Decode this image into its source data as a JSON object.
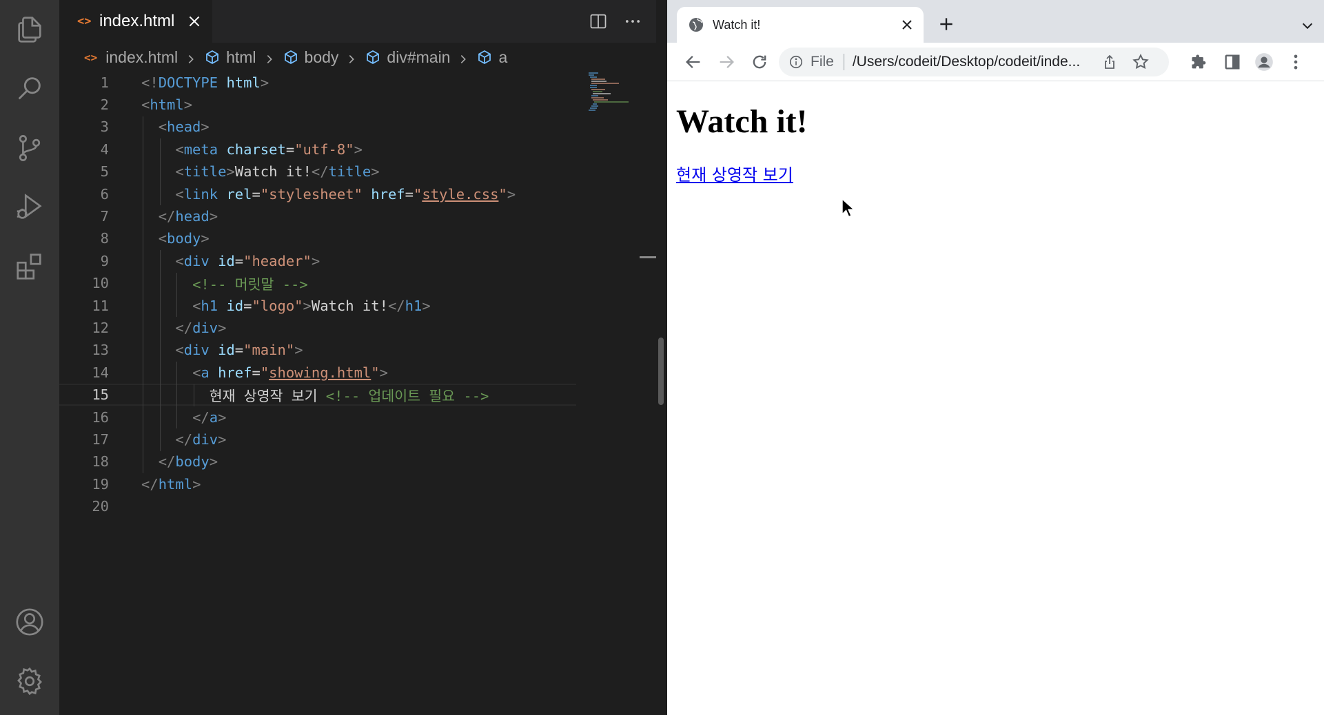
{
  "editor": {
    "tab": {
      "icon": "<>",
      "label": "index.html"
    },
    "breadcrumb": {
      "file_icon": "<>",
      "file": "index.html",
      "items": [
        "html",
        "body",
        "div#main",
        "a"
      ]
    },
    "lines": [
      {
        "num": "1",
        "tokens": [
          [
            "tg",
            "<!"
          ],
          [
            "tn",
            "DOCTYPE"
          ],
          [
            "tx",
            " "
          ],
          [
            "at",
            "html"
          ],
          [
            "tg",
            ">"
          ]
        ]
      },
      {
        "num": "2",
        "tokens": [
          [
            "tg",
            "<"
          ],
          [
            "tn",
            "html"
          ],
          [
            "tg",
            ">"
          ]
        ]
      },
      {
        "num": "3",
        "tokens": [
          [
            "tx",
            "  "
          ],
          [
            "tg",
            "<"
          ],
          [
            "tn",
            "head"
          ],
          [
            "tg",
            ">"
          ]
        ]
      },
      {
        "num": "4",
        "tokens": [
          [
            "tx",
            "    "
          ],
          [
            "tg",
            "<"
          ],
          [
            "tn",
            "meta"
          ],
          [
            "tx",
            " "
          ],
          [
            "at",
            "charset"
          ],
          [
            "tx",
            "="
          ],
          [
            "st",
            "\"utf-8\""
          ],
          [
            "tg",
            ">"
          ]
        ]
      },
      {
        "num": "5",
        "tokens": [
          [
            "tx",
            "    "
          ],
          [
            "tg",
            "<"
          ],
          [
            "tn",
            "title"
          ],
          [
            "tg",
            ">"
          ],
          [
            "tx",
            "Watch it!"
          ],
          [
            "tg",
            "</"
          ],
          [
            "tn",
            "title"
          ],
          [
            "tg",
            ">"
          ]
        ]
      },
      {
        "num": "6",
        "tokens": [
          [
            "tx",
            "    "
          ],
          [
            "tg",
            "<"
          ],
          [
            "tn",
            "link"
          ],
          [
            "tx",
            " "
          ],
          [
            "at",
            "rel"
          ],
          [
            "tx",
            "="
          ],
          [
            "st",
            "\"stylesheet\""
          ],
          [
            "tx",
            " "
          ],
          [
            "at",
            "href"
          ],
          [
            "tx",
            "="
          ],
          [
            "st",
            "\""
          ],
          [
            "stu",
            "style.css"
          ],
          [
            "st",
            "\""
          ],
          [
            "tg",
            ">"
          ]
        ]
      },
      {
        "num": "7",
        "tokens": [
          [
            "tx",
            "  "
          ],
          [
            "tg",
            "</"
          ],
          [
            "tn",
            "head"
          ],
          [
            "tg",
            ">"
          ]
        ]
      },
      {
        "num": "8",
        "tokens": [
          [
            "tx",
            "  "
          ],
          [
            "tg",
            "<"
          ],
          [
            "tn",
            "body"
          ],
          [
            "tg",
            ">"
          ]
        ]
      },
      {
        "num": "9",
        "tokens": [
          [
            "tx",
            "    "
          ],
          [
            "tg",
            "<"
          ],
          [
            "tn",
            "div"
          ],
          [
            "tx",
            " "
          ],
          [
            "at",
            "id"
          ],
          [
            "tx",
            "="
          ],
          [
            "st",
            "\"header\""
          ],
          [
            "tg",
            ">"
          ]
        ]
      },
      {
        "num": "10",
        "tokens": [
          [
            "tx",
            "      "
          ],
          [
            "cm",
            "<!-- 머릿말 -->"
          ]
        ]
      },
      {
        "num": "11",
        "tokens": [
          [
            "tx",
            "      "
          ],
          [
            "tg",
            "<"
          ],
          [
            "tn",
            "h1"
          ],
          [
            "tx",
            " "
          ],
          [
            "at",
            "id"
          ],
          [
            "tx",
            "="
          ],
          [
            "st",
            "\"logo\""
          ],
          [
            "tg",
            ">"
          ],
          [
            "tx",
            "Watch it!"
          ],
          [
            "tg",
            "</"
          ],
          [
            "tn",
            "h1"
          ],
          [
            "tg",
            ">"
          ]
        ]
      },
      {
        "num": "12",
        "tokens": [
          [
            "tx",
            "    "
          ],
          [
            "tg",
            "</"
          ],
          [
            "tn",
            "div"
          ],
          [
            "tg",
            ">"
          ]
        ]
      },
      {
        "num": "13",
        "tokens": [
          [
            "tx",
            "    "
          ],
          [
            "tg",
            "<"
          ],
          [
            "tn",
            "div"
          ],
          [
            "tx",
            " "
          ],
          [
            "at",
            "id"
          ],
          [
            "tx",
            "="
          ],
          [
            "st",
            "\"main\""
          ],
          [
            "tg",
            ">"
          ]
        ]
      },
      {
        "num": "14",
        "tokens": [
          [
            "tx",
            "      "
          ],
          [
            "tg",
            "<"
          ],
          [
            "tn",
            "a"
          ],
          [
            "tx",
            " "
          ],
          [
            "at",
            "href"
          ],
          [
            "tx",
            "="
          ],
          [
            "st",
            "\""
          ],
          [
            "stu",
            "showing.html"
          ],
          [
            "st",
            "\""
          ],
          [
            "tg",
            ">"
          ]
        ]
      },
      {
        "num": "15",
        "tokens": [
          [
            "tx",
            "        현재 상영작 보기 "
          ],
          [
            "cm",
            "<!-- 업데이트 필요 -->"
          ]
        ]
      },
      {
        "num": "16",
        "tokens": [
          [
            "tx",
            "      "
          ],
          [
            "tg",
            "</"
          ],
          [
            "tn",
            "a"
          ],
          [
            "tg",
            ">"
          ]
        ]
      },
      {
        "num": "17",
        "tokens": [
          [
            "tx",
            "    "
          ],
          [
            "tg",
            "</"
          ],
          [
            "tn",
            "div"
          ],
          [
            "tg",
            ">"
          ]
        ]
      },
      {
        "num": "18",
        "tokens": [
          [
            "tx",
            "  "
          ],
          [
            "tg",
            "</"
          ],
          [
            "tn",
            "body"
          ],
          [
            "tg",
            ">"
          ]
        ]
      },
      {
        "num": "19",
        "tokens": [
          [
            "tg",
            "</"
          ],
          [
            "tn",
            "html"
          ],
          [
            "tg",
            ">"
          ]
        ]
      },
      {
        "num": "20",
        "tokens": []
      }
    ],
    "active_line": "15"
  },
  "activity_bar": {
    "top": [
      "files-icon",
      "search-icon",
      "source-control-icon",
      "run-debug-icon",
      "extensions-icon"
    ],
    "bottom": [
      "account-icon",
      "settings-gear-icon"
    ]
  },
  "browser": {
    "tab_title": "Watch it!",
    "omnibox": {
      "scheme": "File",
      "url": "/Users/codeit/Desktop/codeit/inde..."
    },
    "page": {
      "heading": "Watch it!",
      "link_text": "현재 상영작 보기"
    }
  },
  "colors": {
    "editor_bg": "#1e1e1e",
    "activity_bar_bg": "#333333",
    "tag": "#569cd6",
    "attribute": "#9cdcfe",
    "string": "#ce9178",
    "comment": "#6a9955",
    "link": "#0000ee"
  }
}
